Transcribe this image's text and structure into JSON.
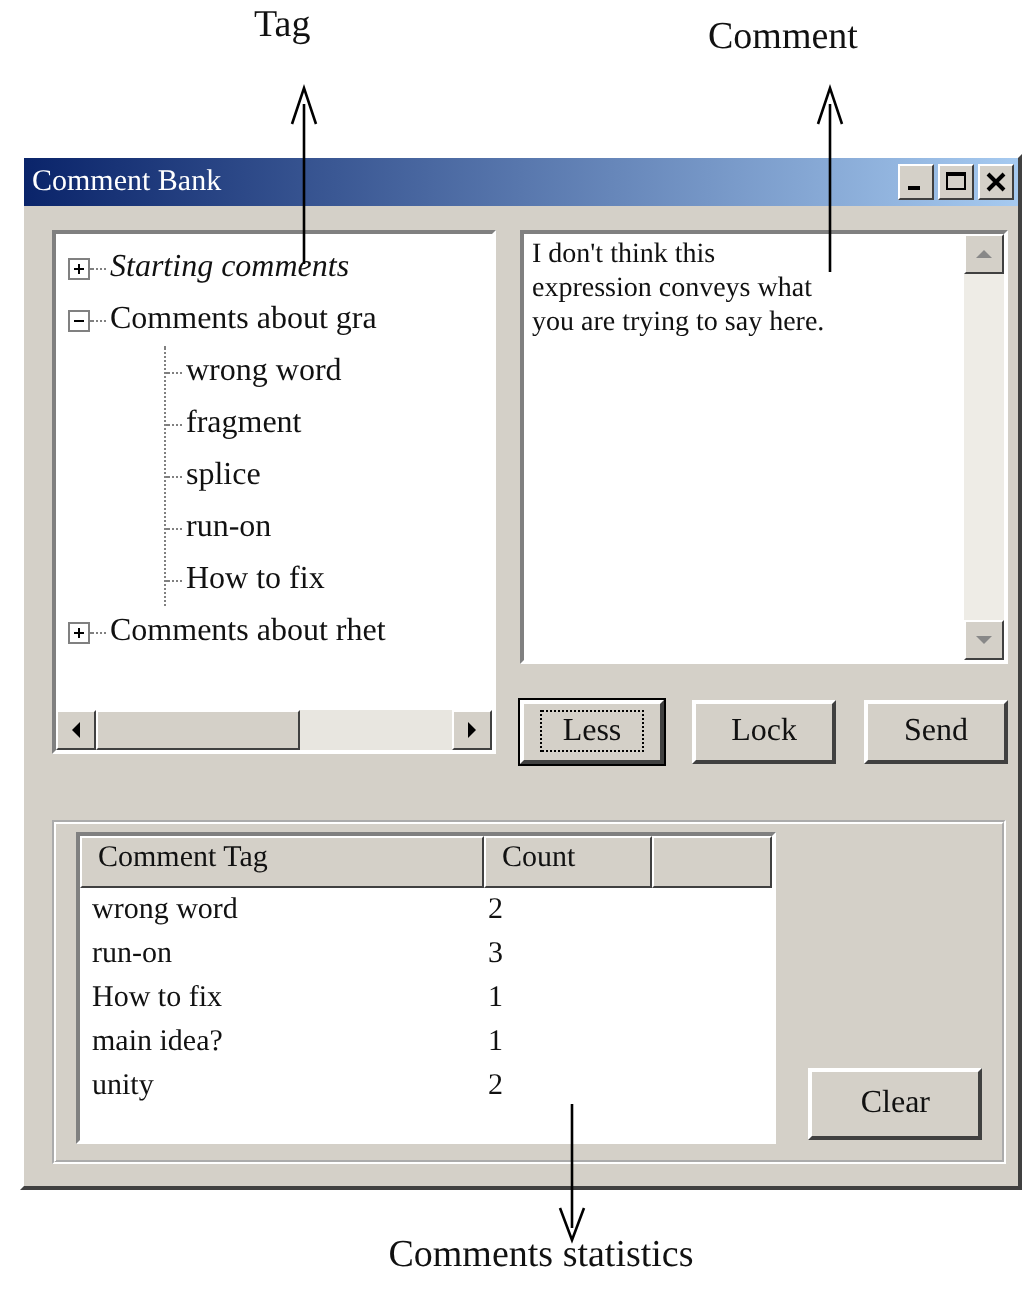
{
  "callouts": {
    "tag": "Tag",
    "comment": "Comment",
    "statistics": "Comments statistics"
  },
  "window": {
    "title": "Comment Bank"
  },
  "tree": [
    {
      "label": "Starting comments",
      "expanded": false
    },
    {
      "label": "Comments about gra",
      "expanded": true,
      "children": [
        {
          "label": "wrong word"
        },
        {
          "label": "fragment"
        },
        {
          "label": "splice"
        },
        {
          "label": "run-on"
        },
        {
          "label": "How to fix"
        }
      ]
    },
    {
      "label": "Comments about rhet",
      "expanded": false
    }
  ],
  "comment": {
    "value": "I don't think this expression conveys what you are trying to say here."
  },
  "buttons": [
    {
      "label": "Less",
      "default": true
    },
    {
      "label": "Lock",
      "default": false
    },
    {
      "label": "Send",
      "default": false
    }
  ],
  "stats": {
    "columns": [
      "Comment Tag",
      "Count"
    ],
    "rows": [
      {
        "tag": "wrong word",
        "count": "2"
      },
      {
        "tag": "run-on",
        "count": "3"
      },
      {
        "tag": "How to fix",
        "count": "1"
      },
      {
        "tag": "main idea?",
        "count": "1"
      },
      {
        "tag": "unity",
        "count": "2"
      }
    ]
  },
  "clear_button": "Clear"
}
